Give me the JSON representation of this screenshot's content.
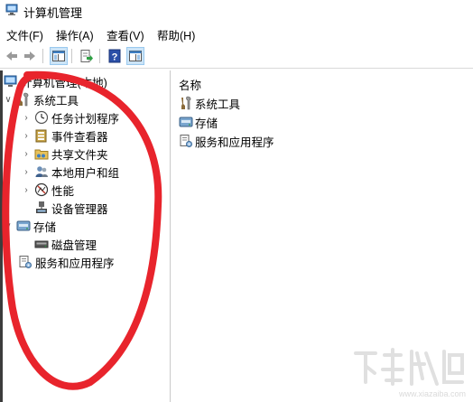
{
  "window": {
    "title": "计算机管理"
  },
  "menu": [
    "文件(F)",
    "操作(A)",
    "查看(V)",
    "帮助(H)"
  ],
  "toolbar": [
    "back-icon",
    "forward-icon",
    "show-hide-tree-icon",
    "export-list-icon",
    "help-icon",
    "show-action-pane-icon"
  ],
  "tree": {
    "root": "计算机管理(本地)",
    "system_tools": "系统工具",
    "children": [
      "任务计划程序",
      "事件查看器",
      "共享文件夹",
      "本地用户和组",
      "性能",
      "设备管理器"
    ],
    "storage": "存储",
    "disk": "磁盘管理",
    "services": "服务和应用程序"
  },
  "list": {
    "column": "名称",
    "items": [
      "系统工具",
      "存储",
      "服务和应用程序"
    ]
  },
  "annotation_color": "#e8242c",
  "watermark": {
    "site": "www.xiazaiba.com"
  }
}
